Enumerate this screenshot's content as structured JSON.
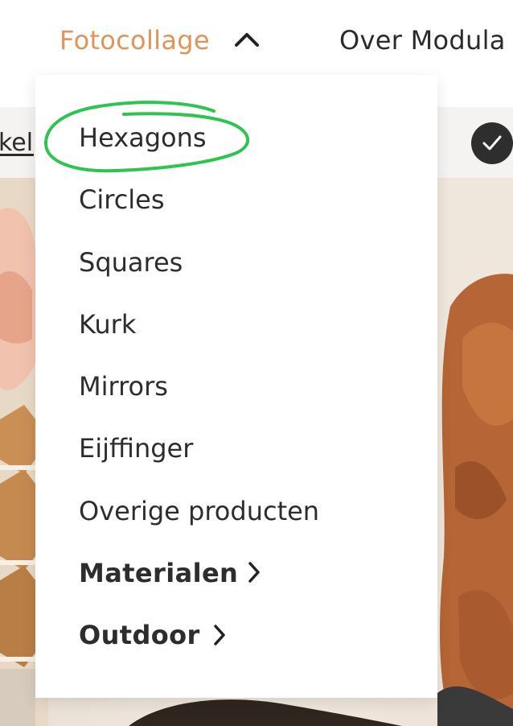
{
  "nav": {
    "items": [
      {
        "label": "Fotocollage",
        "active": true,
        "expanded": true
      },
      {
        "label": "Over Modula"
      }
    ],
    "chevron_icon": "chevron-up-icon"
  },
  "strip": {
    "link_text": "keli",
    "badge_icon": "checkmark-icon"
  },
  "dropdown": {
    "items": [
      {
        "label": "Hexagons",
        "highlighted": true
      },
      {
        "label": "Circles"
      },
      {
        "label": "Squares"
      },
      {
        "label": "Kurk"
      },
      {
        "label": "Mirrors"
      },
      {
        "label": "Eijffinger"
      },
      {
        "label": "Overige producten"
      },
      {
        "label": "Materialen",
        "bold": true,
        "has_submenu": true
      },
      {
        "label": "Outdoor",
        "bold": true,
        "has_submenu": true
      }
    ]
  },
  "colors": {
    "accent_orange": "#e0945a",
    "text_dark": "#2d2d2d",
    "annotation_green": "#2ec44f",
    "strip_bg": "#f4f3f1",
    "badge_bg": "#2e2e2e"
  }
}
